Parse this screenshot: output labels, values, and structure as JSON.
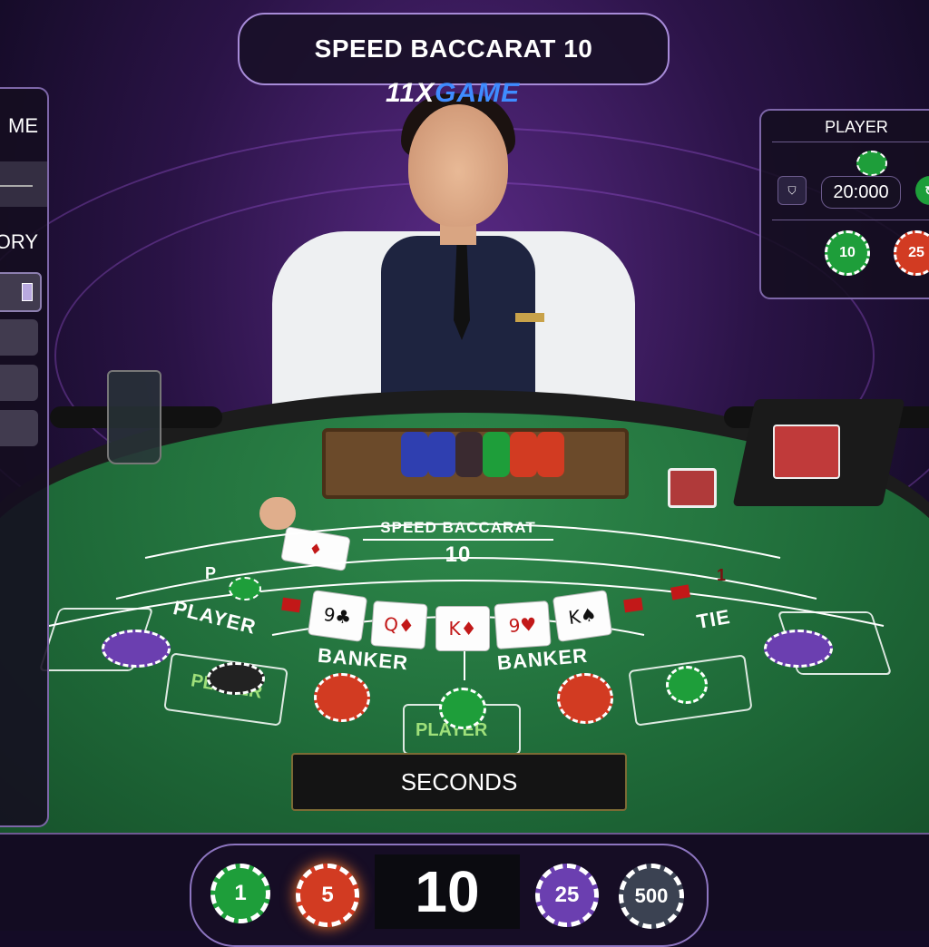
{
  "header": {
    "title": "SPEED BACCARAT 10",
    "brand": {
      "prefix": "11X",
      "suffix": "GAME"
    }
  },
  "left_panel": {
    "label_top": "ME",
    "label_mid": "ORY"
  },
  "right_panel": {
    "title": "PLAYER",
    "amount": "20:000",
    "chips": [
      {
        "value": "10",
        "color": "#1e9e3a"
      },
      {
        "value": "25",
        "color": "#d23b22"
      }
    ]
  },
  "table": {
    "title": "SPEED BACCARAT",
    "number": "10",
    "markings": {
      "p": "P",
      "player": "PLAYER",
      "banker_left": "BANKER",
      "banker_right": "BANKER",
      "tie": "TIE",
      "one": "1",
      "box_player_left": "PLAYER",
      "box_player_center": "PLAYER"
    },
    "cards": [
      {
        "rank": "9♣",
        "color": "black"
      },
      {
        "rank": "Q♦",
        "color": "red"
      },
      {
        "rank": "K♦",
        "color": "red"
      },
      {
        "rank": "9♥",
        "color": "red"
      },
      {
        "rank": "K♠",
        "color": "black"
      }
    ]
  },
  "timer": {
    "label": "SECONDS"
  },
  "chip_selector": {
    "chips": [
      {
        "value": "1",
        "color": "#1e9e3a"
      },
      {
        "value": "5",
        "color": "#d23b22"
      },
      {
        "value": "25",
        "color": "#6b3fb0"
      },
      {
        "value": "500",
        "color": "#3b4252"
      }
    ],
    "current_bet": "10"
  },
  "colors": {
    "felt": "#1f6b39",
    "panel_border": "#a78bd8",
    "accent": "#3f8cff"
  }
}
